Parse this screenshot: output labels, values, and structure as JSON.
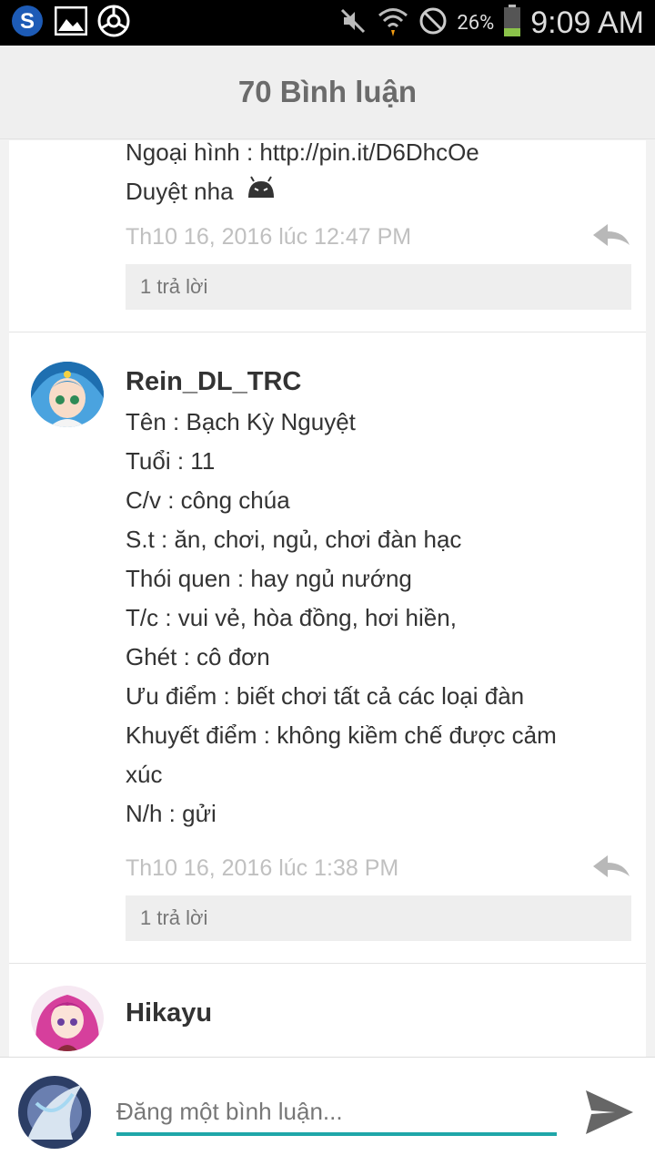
{
  "status_bar": {
    "battery_pct": "26%",
    "time": "9:09 AM"
  },
  "header": {
    "title": "70 Bình luận"
  },
  "comments": [
    {
      "author": "",
      "lines": [
        "Ngoại hình : http://pin.it/D6DhcOe",
        "Duyệt nha"
      ],
      "time": "Th10 16, 2016 lúc 12:47 PM",
      "replies": "1 trả lời"
    },
    {
      "author": "Rein_DL_TRC",
      "lines": [
        "Tên : Bạch Kỳ Nguyệt",
        "Tuổi : 11",
        "C/v : công chúa",
        "S.t : ăn, chơi, ngủ, chơi đàn hạc",
        "Thói quen : hay ngủ nướng",
        "T/c : vui vẻ, hòa đồng, hơi hiền,",
        "Ghét : cô đơn",
        "Ưu điểm : biết chơi tất cả các loại đàn",
        "Khuyết điểm : không kiềm chế được cảm",
        "xúc",
        "N/h : gửi"
      ],
      "time": "Th10 16, 2016 lúc 1:38 PM",
      "replies": "1 trả lời"
    },
    {
      "author": "Hikayu"
    }
  ],
  "composer": {
    "placeholder": "Đăng một bình luận..."
  },
  "colors": {
    "accent": "#1fa6a8",
    "reply_icon": "#b8b8b8"
  }
}
